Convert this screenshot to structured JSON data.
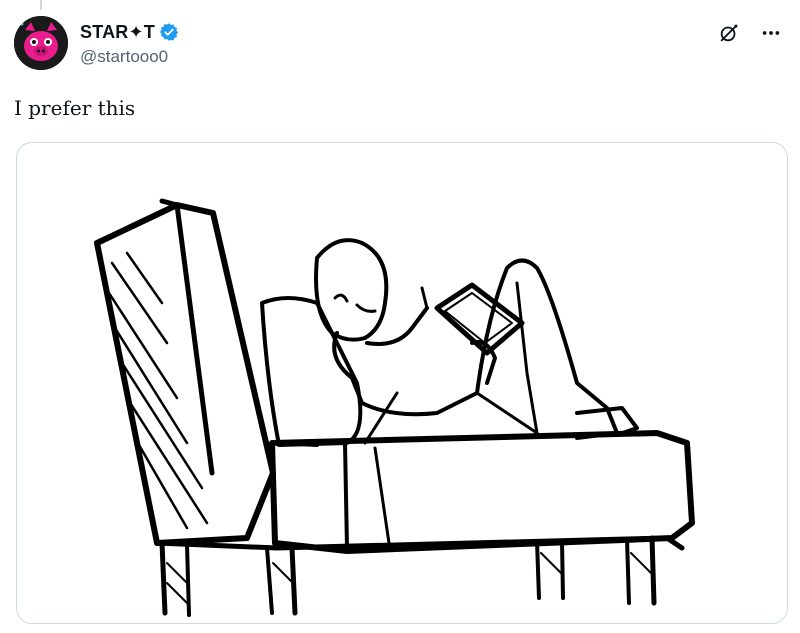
{
  "tweet": {
    "display_name": "STAR✦T",
    "handle": "@startooo0",
    "text": "I prefer this"
  },
  "icons": {
    "verified": "verified-badge-icon",
    "grok": "grok-icon",
    "more": "more-icon"
  },
  "colors": {
    "verified": "#1d9bf0",
    "handle": "#536471",
    "avatar_bg": "#1a1a1a",
    "avatar_face": "#e91e8c"
  },
  "media": {
    "type": "image",
    "subject": "sketch of a person lying on a couch drawing on a tablet"
  }
}
